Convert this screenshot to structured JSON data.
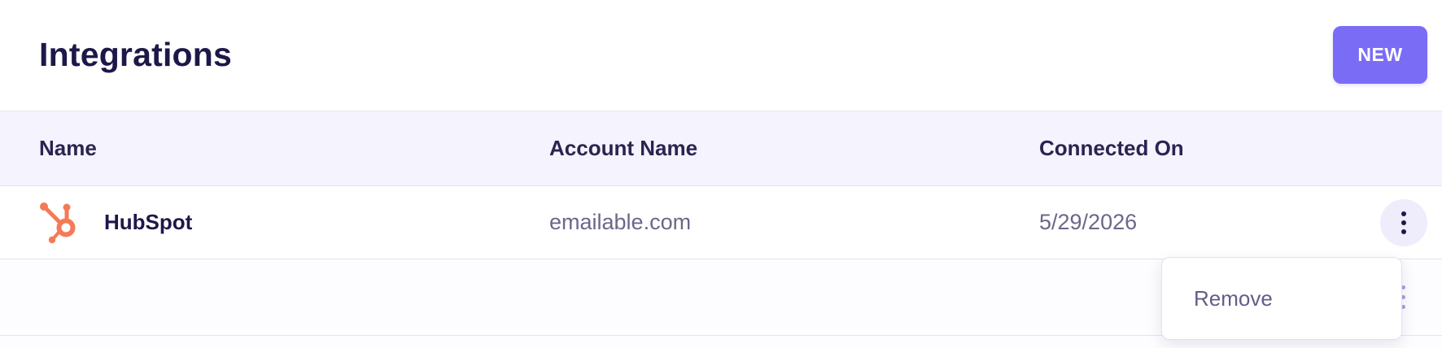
{
  "page": {
    "title": "Integrations",
    "new_button_label": "NEW"
  },
  "table": {
    "columns": [
      "Name",
      "Account Name",
      "Connected On"
    ],
    "rows": [
      {
        "icon": "hubspot-logo-icon",
        "name": "HubSpot",
        "account_name": "emailable.com",
        "connected_on": "5/29/2026"
      }
    ]
  },
  "row_menu": {
    "items": [
      "Remove"
    ]
  },
  "colors": {
    "accent": "#7b6cf6",
    "hubspot_orange": "#f57a57",
    "header_background": "#f5f3fd",
    "title_text": "#1d1849"
  }
}
